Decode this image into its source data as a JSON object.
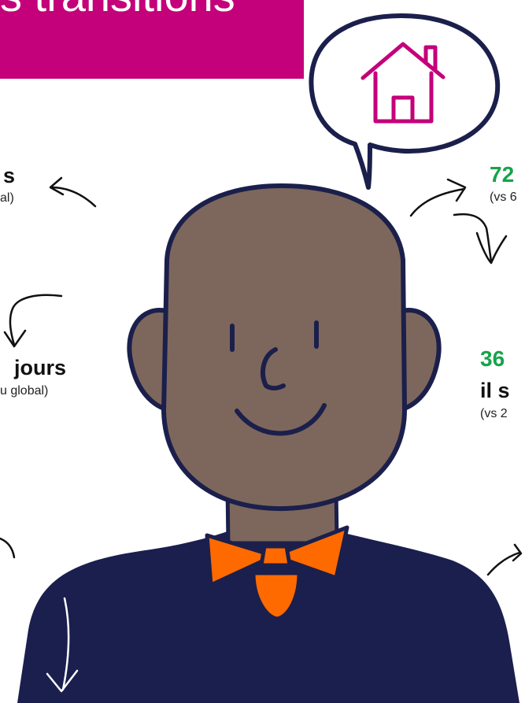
{
  "colors": {
    "banner": "#c4007a",
    "skin": "#7d675c",
    "outline": "#1b1f4b",
    "shirt": "#1a1f4e",
    "bowtie": "#ff6a00",
    "house": "#c4007a",
    "stat_green": "#16a34a"
  },
  "banner": {
    "text": "s transitions"
  },
  "speech_bubble": {
    "icon": "house-icon"
  },
  "left_stats": {
    "top_title": "s",
    "top_note": "al)",
    "middle_title": "jours",
    "middle_note": "u global)"
  },
  "right_stats": {
    "top_value": "72",
    "top_note": "(vs 6",
    "bottom_value": "36",
    "bottom_title": "il s",
    "bottom_note": "(vs 2"
  },
  "arrows": [
    "arrow-left-top",
    "arrow-left-curl",
    "arrow-left-bottom",
    "arrow-right-top",
    "arrow-right-curl",
    "arrow-right-bottom"
  ]
}
